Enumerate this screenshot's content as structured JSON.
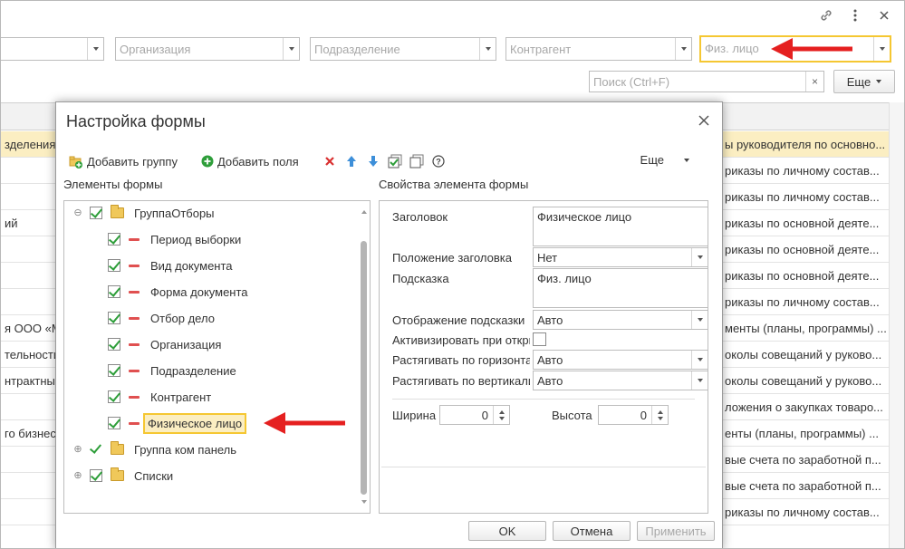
{
  "window_icons": {
    "link": "link-icon",
    "menu": "more-vertical-icon",
    "close": "close-icon"
  },
  "filters": {
    "first_placeholder": "",
    "organization": "Организация",
    "department": "Подразделение",
    "counterparty": "Контрагент",
    "individual": "Физ. лицо"
  },
  "search": {
    "placeholder": "Поиск (Ctrl+F)"
  },
  "top_more": "Еще",
  "background_rows": [
    {
      "left": "зделения",
      "right": "ы руководителя по основно..."
    },
    {
      "left": "",
      "right": "риказы по личному состав..."
    },
    {
      "left": "",
      "right": "риказы по личному состав..."
    },
    {
      "left": "ий",
      "right": "риказы по основной деяте..."
    },
    {
      "left": "",
      "right": "риказы по основной деяте..."
    },
    {
      "left": "",
      "right": "риказы по основной деяте..."
    },
    {
      "left": "",
      "right": "риказы по личному состав..."
    },
    {
      "left": "я ООО «М",
      "right": "менты (планы, программы) ..."
    },
    {
      "left": "тельности",
      "right": "околы совещаний у руково..."
    },
    {
      "left": "нтрактных",
      "right": "околы совещаний у руково..."
    },
    {
      "left": "",
      "right": "ложения о закупках товаро..."
    },
    {
      "left": "го бизнес",
      "right": "енты (планы, программы) ..."
    },
    {
      "left": "",
      "right": "вые счета по заработной п..."
    },
    {
      "left": "",
      "right": "вые счета по заработной п..."
    },
    {
      "left": "",
      "right": "риказы по личному состав..."
    }
  ],
  "dialog": {
    "title": "Настройка формы",
    "toolbar": {
      "add_group": "Добавить группу",
      "add_fields": "Добавить поля",
      "more": "Еще"
    },
    "elements_label": "Элементы формы",
    "properties_label": "Свойства элемента формы",
    "tree": [
      {
        "label": "ГруппаОтборы",
        "level": 0,
        "kind": "group"
      },
      {
        "label": "Период выборки",
        "level": 1,
        "kind": "field"
      },
      {
        "label": "Вид документа",
        "level": 1,
        "kind": "field"
      },
      {
        "label": "Форма документа",
        "level": 1,
        "kind": "field"
      },
      {
        "label": "Отбор дело",
        "level": 1,
        "kind": "field"
      },
      {
        "label": "Организация",
        "level": 1,
        "kind": "field"
      },
      {
        "label": "Подразделение",
        "level": 1,
        "kind": "field"
      },
      {
        "label": "Контрагент",
        "level": 1,
        "kind": "field"
      },
      {
        "label": "Физическое лицо",
        "level": 1,
        "kind": "field",
        "highlighted": true
      },
      {
        "label": "Группа ком панель",
        "level": 0,
        "kind": "group"
      },
      {
        "label": "Списки",
        "level": 0,
        "kind": "group"
      }
    ],
    "props": {
      "title_label": "Заголовок",
      "title_value": "Физическое лицо",
      "title_pos_label": "Положение заголовка",
      "title_pos_value": "Нет",
      "hint_label": "Подсказка",
      "hint_value": "Физ. лицо",
      "hint_display_label": "Отображение подсказки",
      "hint_display_value": "Авто",
      "activate_label": "Активизировать при откры",
      "stretch_h_label": "Растягивать по горизонта",
      "stretch_h_value": "Авто",
      "stretch_v_label": "Растягивать по вертикали",
      "stretch_v_value": "Авто",
      "width_label": "Ширина",
      "width_value": "0",
      "height_label": "Высота",
      "height_value": "0"
    },
    "buttons": {
      "ok": "OK",
      "cancel": "Отмена",
      "apply": "Применить"
    }
  },
  "colors": {
    "highlight_border": "#f5c732",
    "highlight_fill": "#fbeec2",
    "arrow": "#e52020",
    "check": "#2e9e3a"
  }
}
